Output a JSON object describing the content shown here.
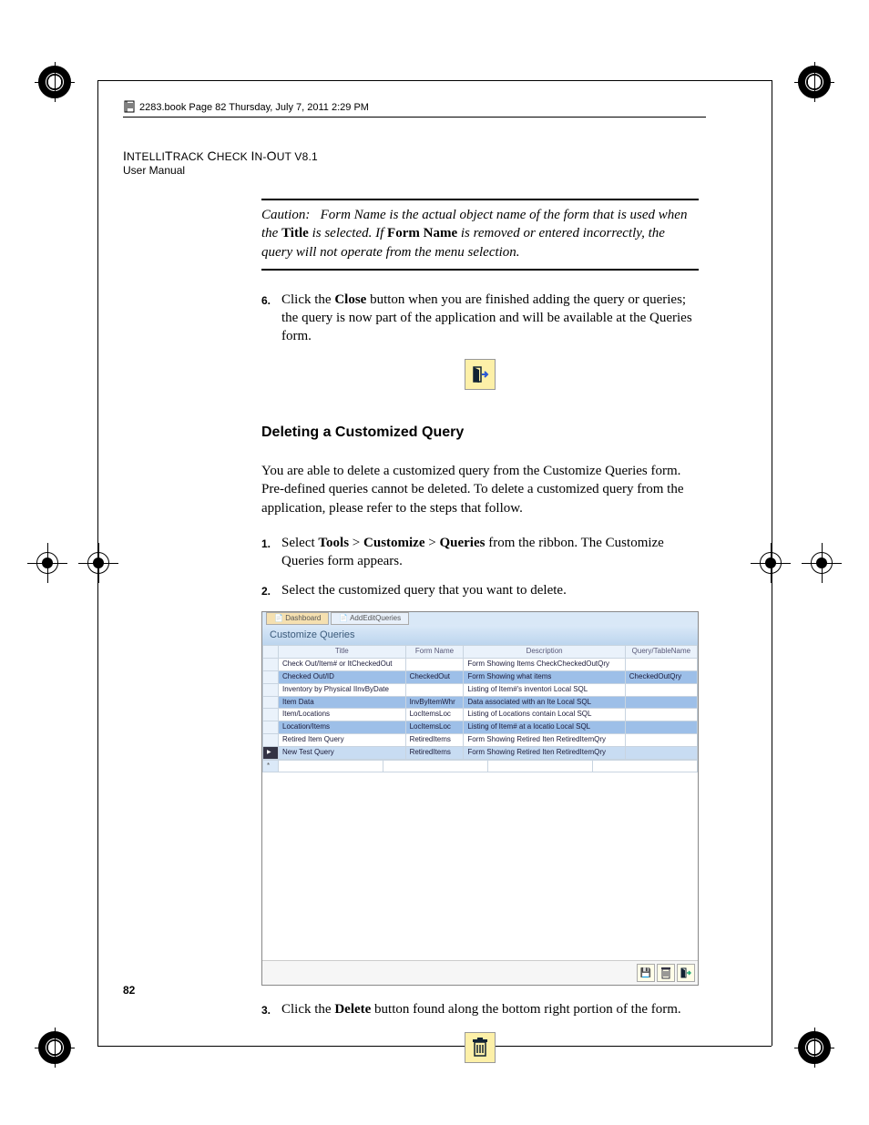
{
  "bookline": "2283.book  Page 82  Thursday, July 7, 2011  2:29 PM",
  "header": {
    "title_caps": "NTELLI",
    "title_rest": "RACK ",
    "title2_caps": "HECK ",
    "title3_caps": "N-",
    "title4_caps": "UT V",
    "version": "8.1",
    "sub": "User Manual",
    "I": "I",
    "T": "T",
    "C": "C",
    "O": "O"
  },
  "caution": {
    "label": "Caution:",
    "t1": "Form Name is the actual object name of the form that is used when the ",
    "b1": "Title",
    "t2": " is selected. If ",
    "b2": "Form Name",
    "t3": " is removed or entered incorrectly, the query will not operate from the menu selection."
  },
  "step6": {
    "num": "6.",
    "a": "Click the ",
    "b": "Close",
    "c": " button when you are finished adding the query or queries; the query is now part of the application and will be available at the Queries form."
  },
  "subhead": "Deleting a Customized Query",
  "intro": "You are able to delete a customized query from the Customize Queries form. Pre-defined queries cannot be deleted. To delete a customized query from the application, please refer to the steps that follow.",
  "step1": {
    "num": "1.",
    "a": "Select ",
    "b": "Tools",
    "gt1": " > ",
    "c": "Customize",
    "gt2": " > ",
    "d": "Queries",
    "e": " from the ribbon. The Customize Queries form appears."
  },
  "step2": {
    "num": "2.",
    "a": "Select the customized query that you want to delete."
  },
  "step3": {
    "num": "3.",
    "a": "Click the ",
    "b": "Delete",
    "c": " button found along the bottom right portion of the form."
  },
  "screenshot": {
    "tabs": [
      "Dashboard",
      "AddEditQueries"
    ],
    "title": "Customize Queries",
    "cols": [
      "Title",
      "Form Name",
      "Description",
      "Query/TableName"
    ],
    "rows": [
      {
        "sel": false,
        "c": [
          "Check Out/Item# or ItCheckedOut",
          "",
          "Form Showing Items CheckCheckedOutQry",
          ""
        ]
      },
      {
        "sel": true,
        "c": [
          "Checked Out/ID",
          "CheckedOut",
          "Form Showing what items",
          "CheckedOutQry"
        ]
      },
      {
        "sel": false,
        "c": [
          "Inventory by Physical IInvByDate",
          "",
          "Listing of Item#'s inventori Local SQL",
          ""
        ]
      },
      {
        "sel": true,
        "c": [
          "Item Data",
          "InvByItemWhr",
          "Data associated with an Ite Local SQL",
          ""
        ]
      },
      {
        "sel": false,
        "c": [
          "Item/Locations",
          "LocItemsLoc",
          "Listing of Locations contain Local SQL",
          ""
        ]
      },
      {
        "sel": true,
        "c": [
          "Location/Items",
          "LocItemsLoc",
          "Listing of Item# at a locatio Local SQL",
          ""
        ]
      },
      {
        "sel": false,
        "c": [
          "Retired Item Query",
          "RetiredItems",
          "Form Showing Retired Iten RetiredItemQry",
          ""
        ]
      },
      {
        "sel": false,
        "new": true,
        "mark": true,
        "c": [
          "New Test Query",
          "RetiredItems",
          "Form Showing Retired Iten RetiredItemQry",
          ""
        ]
      }
    ]
  },
  "page_num": "82"
}
